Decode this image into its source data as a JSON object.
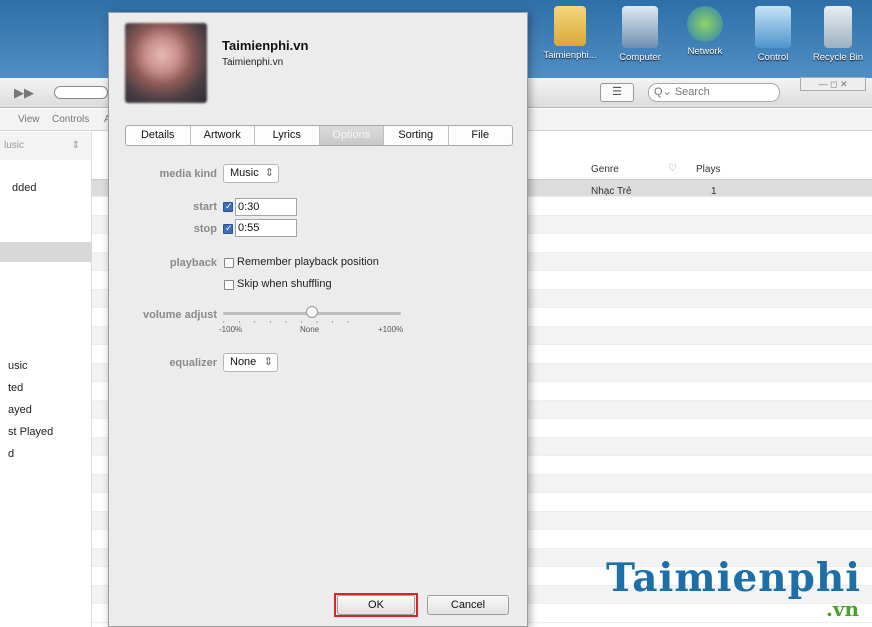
{
  "desktop": {
    "icons": [
      {
        "label": "Taimienphi...",
        "icon": "folder-icon"
      },
      {
        "label": "Computer",
        "icon": "computer-icon"
      },
      {
        "label": "Network",
        "icon": "network-icon"
      },
      {
        "label": "Control",
        "icon": "control-panel-icon"
      },
      {
        "label": "Recycle Bin",
        "icon": "recycle-bin-icon"
      }
    ]
  },
  "itunes": {
    "search_placeholder": "Search",
    "menu": {
      "view": "View",
      "controls": "Controls",
      "more": "A"
    },
    "source_select": "lusic",
    "columns": {
      "genre": "Genre",
      "plays": "Plays"
    },
    "selected_row": {
      "genre": "Nhạc Trẻ",
      "plays": "1"
    },
    "sidebar": {
      "added": "dded",
      "music": "usic",
      "rated": "ted",
      "played": "ayed",
      "last_played": "st Played",
      "d": "d"
    }
  },
  "dialog": {
    "title": "Taimienphi.vn",
    "subtitle": "Taimienphi.vn",
    "tabs": [
      "Details",
      "Artwork",
      "Lyrics",
      "Options",
      "Sorting",
      "File"
    ],
    "active_tab": "Options",
    "media_kind_label": "media kind",
    "media_kind_value": "Music",
    "start_label": "start",
    "start_value": "0:30",
    "stop_label": "stop",
    "stop_value": "0:55",
    "playback_label": "playback",
    "remember_label": "Remember playback position",
    "skip_label": "Skip when shuffling",
    "volume_label": "volume adjust",
    "volume_min": "-100%",
    "volume_mid": "None",
    "volume_max": "+100%",
    "volume_level_percent": 0,
    "equalizer_label": "equalizer",
    "equalizer_value": "None",
    "ok_label": "OK",
    "cancel_label": "Cancel"
  },
  "watermark": {
    "main": "Taimienphi",
    "suffix": ".vn"
  },
  "colors": {
    "accent": "#3c6fb8",
    "ok_highlight": "#d9252a",
    "watermark": "#1d6fa8"
  }
}
